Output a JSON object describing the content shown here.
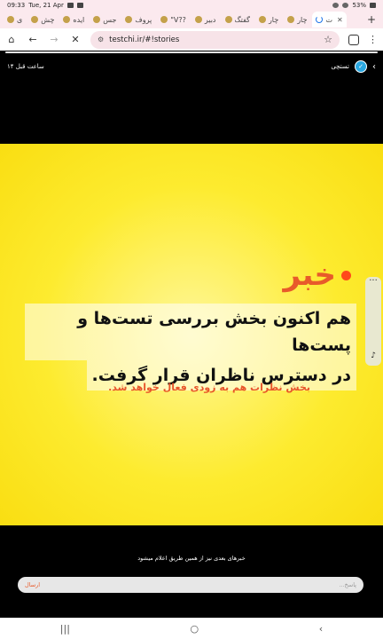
{
  "status_bar": {
    "time": "09:33",
    "date": "Tue, 21 Apr",
    "battery": "53%"
  },
  "tabs": [
    {
      "label": "چار"
    },
    {
      "label": "چار"
    },
    {
      "label": "گفتگ"
    },
    {
      "label": "دبیر"
    },
    {
      "label": "\"V??"
    },
    {
      "label": "پروف"
    },
    {
      "label": "جس"
    },
    {
      "label": "ایده"
    },
    {
      "label": "چش"
    },
    {
      "label": "ی"
    }
  ],
  "active_tab": {
    "label": "ت"
  },
  "address": {
    "url": "testchi.ir/#!stories"
  },
  "story": {
    "author": "تستچی",
    "time_ago": "۱۴ ساعت قبل",
    "progress": 1.0,
    "headline": "خبر",
    "line1": "هم اکنون بخش بررسی تست‌ها و پست‌ها",
    "line2": "در دسترس ناظران قرار گرفت.",
    "subtext": "بخش نظرات هم به زودی فعال خواهد شد.",
    "caption": "خبرهای بعدی نیز از همین طریق اعلام میشود",
    "reply_placeholder": "پاسخ...",
    "send_label": "ارسال"
  },
  "colors": {
    "accent": "#e85a2a",
    "story_bg": "#fdeb2f",
    "chrome_bg": "#fbe9ee"
  }
}
